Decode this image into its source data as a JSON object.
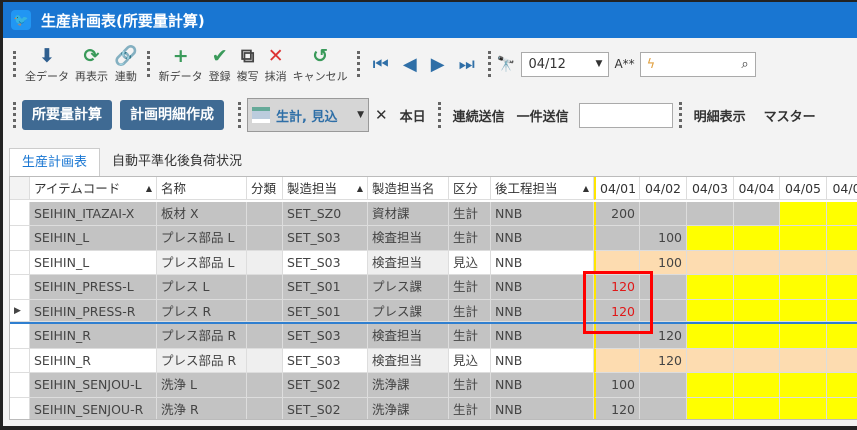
{
  "window": {
    "title": "生産計画表(所要量計算)"
  },
  "toolbar1": {
    "tools": [
      {
        "icon": "download-icon",
        "label": "全データ",
        "glyph": "⬇",
        "color": "#2f5f8f"
      },
      {
        "icon": "refresh-icon",
        "label": "再表示",
        "glyph": "⟳",
        "color": "#3a9a5a"
      },
      {
        "icon": "link-icon",
        "label": "連動",
        "glyph": "🔗",
        "color": "#555"
      }
    ],
    "tools2": [
      {
        "icon": "plus-icon",
        "label": "新データ",
        "glyph": "+",
        "color": "#3a9a5a"
      },
      {
        "icon": "check-icon",
        "label": "登録",
        "glyph": "✔",
        "color": "#3a9a5a"
      },
      {
        "icon": "copy-icon",
        "label": "複写",
        "glyph": "⧉",
        "color": "#444"
      },
      {
        "icon": "close-icon",
        "label": "抹消",
        "glyph": "✕",
        "color": "#d33"
      },
      {
        "icon": "undo-icon",
        "label": "キャンセル",
        "glyph": "↺",
        "color": "#3a9a5a"
      }
    ],
    "date_value": "04/12",
    "font_label": "A**"
  },
  "toolbar2": {
    "calc_button": "所要量計算",
    "detail_button": "計画明細作成",
    "filter_value": "生計, 見込",
    "today": "本日",
    "continuous_send": "連続送信",
    "single_send": "一件送信",
    "single_send_value": "",
    "detail_view": "明細表示",
    "master": "マスター"
  },
  "tabs": [
    "生産計画表",
    "自動平準化後負荷状況"
  ],
  "grid": {
    "columns": [
      "アイテムコード",
      "名称",
      "分類",
      "製造担当",
      "製造担当名",
      "区分",
      "後工程担当",
      "04/01",
      "04/02",
      "04/03",
      "04/04",
      "04/05",
      "04/0"
    ],
    "sorted_columns": [
      0,
      3,
      6
    ],
    "colors": {
      "gray": "#c3c3c3",
      "yellow": "#ffff00",
      "peach": "#fddcb0",
      "white": "#ffffff",
      "light": "#efefef",
      "alert": "#e01818"
    },
    "rows": [
      {
        "cells": [
          "SEIHIN_ITAZAI-X",
          "板材 X",
          "",
          "SET_SZ0",
          "資材課",
          "生計",
          "NNB",
          "200",
          "",
          "",
          "",
          "",
          ""
        ],
        "type": "plan",
        "date_colors": [
          "gray",
          "gray",
          "gray",
          "gray",
          "yellow",
          "yellow"
        ]
      },
      {
        "cells": [
          "SEIHIN_L",
          "プレス部品 L",
          "",
          "SET_S03",
          "検査担当",
          "生計",
          "NNB",
          "",
          "100",
          "",
          "",
          "",
          ""
        ],
        "type": "plan",
        "date_colors": [
          "gray",
          "gray",
          "yellow",
          "yellow",
          "yellow",
          "yellow"
        ]
      },
      {
        "cells": [
          "SEIHIN_L",
          "プレス部品 L",
          "",
          "SET_S03",
          "検査担当",
          "見込",
          "NNB",
          "",
          "100",
          "",
          "",
          "",
          ""
        ],
        "type": "forecast",
        "date_colors": [
          "peach",
          "peach",
          "peach",
          "peach",
          "peach",
          "peach"
        ]
      },
      {
        "cells": [
          "SEIHIN_PRESS-L",
          "プレス L",
          "",
          "SET_S01",
          "プレス課",
          "生計",
          "NNB",
          "120",
          "",
          "",
          "",
          "",
          ""
        ],
        "type": "plan",
        "alert": true,
        "date_colors": [
          "gray",
          "gray",
          "yellow",
          "yellow",
          "yellow",
          "yellow"
        ]
      },
      {
        "cells": [
          "SEIHIN_PRESS-R",
          "プレス R",
          "",
          "SET_S01",
          "プレス課",
          "生計",
          "NNB",
          "120",
          "",
          "",
          "",
          "",
          ""
        ],
        "type": "plan",
        "alert": true,
        "selected": true,
        "date_colors": [
          "gray",
          "gray",
          "yellow",
          "yellow",
          "yellow",
          "yellow"
        ]
      },
      {
        "cells": [
          "SEIHIN_R",
          "プレス部品 R",
          "",
          "SET_S03",
          "検査担当",
          "生計",
          "NNB",
          "",
          "120",
          "",
          "",
          "",
          ""
        ],
        "type": "plan",
        "date_colors": [
          "gray",
          "gray",
          "yellow",
          "yellow",
          "yellow",
          "yellow"
        ]
      },
      {
        "cells": [
          "SEIHIN_R",
          "プレス部品 R",
          "",
          "SET_S03",
          "検査担当",
          "見込",
          "NNB",
          "",
          "120",
          "",
          "",
          "",
          ""
        ],
        "type": "forecast",
        "date_colors": [
          "peach",
          "peach",
          "peach",
          "peach",
          "peach",
          "peach"
        ]
      },
      {
        "cells": [
          "SEIHIN_SENJOU-L",
          "洗浄 L",
          "",
          "SET_S02",
          "洗浄課",
          "生計",
          "NNB",
          "100",
          "",
          "",
          "",
          "",
          ""
        ],
        "type": "plan",
        "date_colors": [
          "gray",
          "gray",
          "yellow",
          "yellow",
          "yellow",
          "yellow"
        ]
      },
      {
        "cells": [
          "SEIHIN_SENJOU-R",
          "洗浄 R",
          "",
          "SET_S02",
          "洗浄課",
          "生計",
          "NNB",
          "120",
          "",
          "",
          "",
          "",
          ""
        ],
        "type": "plan",
        "date_colors": [
          "gray",
          "gray",
          "yellow",
          "yellow",
          "yellow",
          "yellow"
        ]
      }
    ]
  }
}
